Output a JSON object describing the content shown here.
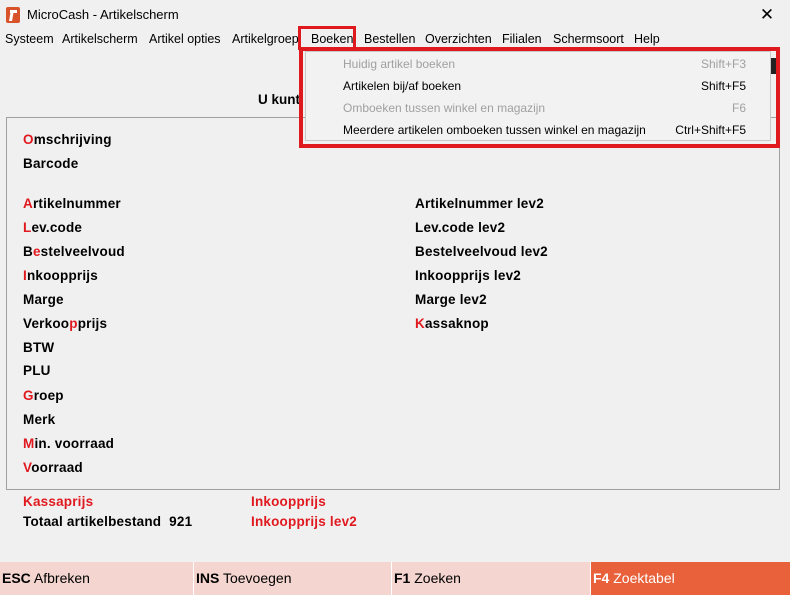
{
  "window": {
    "title": "MicroCash - Artikelscherm",
    "close_glyph": "✕"
  },
  "menu": {
    "items": [
      "Systeem",
      "Artikelscherm",
      "Artikel opties",
      "Artikelgroep",
      "Boeken",
      "Bestellen",
      "Overzichten",
      "Filialen",
      "Schermsoort",
      "Help"
    ]
  },
  "dropdown": {
    "items": [
      {
        "label": "Huidig artikel boeken",
        "shortcut": "Shift+F3",
        "enabled": false
      },
      {
        "label": "Artikelen bij/af boeken",
        "shortcut": "Shift+F5",
        "enabled": true
      },
      {
        "label": "Omboeken tussen winkel en magazijn",
        "shortcut": "F6",
        "enabled": false
      },
      {
        "label": "Meerdere artikelen omboeken tussen winkel en magazijn",
        "shortcut": "Ctrl+Shift+F5",
        "enabled": true
      }
    ]
  },
  "header": {
    "ukunt": "U kunt"
  },
  "fields": {
    "omschrijving": {
      "hot": "O",
      "rest": "mschrijving"
    },
    "barcode": "Barcode",
    "artikelnummer": {
      "hot": "A",
      "rest": "rtikelnummer"
    },
    "levcode": {
      "hot": "L",
      "rest": "ev.code"
    },
    "bestelveelvoud": {
      "pre": "B",
      "hot": "e",
      "rest": "stelveelvoud"
    },
    "inkoopprijs": {
      "hot": "I",
      "rest": "nkoopprijs"
    },
    "marge": "Marge",
    "verkoopprijs": {
      "pre": "Verkoo",
      "hot": "p",
      "rest": "prijs"
    },
    "btw": "BTW",
    "plu": "PLU",
    "groep": {
      "hot": "G",
      "rest": "roep"
    },
    "merk": "Merk",
    "minvoorraad": {
      "hot": "M",
      "rest": "in. voorraad"
    },
    "voorraad": {
      "hot": "V",
      "rest": "oorraad"
    },
    "artikelnummer_lev2": "Artikelnummer lev2",
    "levcode_lev2": "Lev.code lev2",
    "bestelveelvoud_lev2": "Bestelveelvoud lev2",
    "inkoopprijs_lev2": "Inkoopprijs lev2",
    "marge_lev2": "Marge lev2",
    "kassaknop": {
      "hot": "K",
      "rest": "assaknop"
    }
  },
  "summary": {
    "kassaprijs": "Kassaprijs",
    "totaal_label": "Totaal artikelbestand",
    "totaal_value": "921",
    "inkoopprijs": "Inkoopprijs",
    "inkoopprijs_lev2": "Inkoopprijs lev2"
  },
  "footer": {
    "buttons": [
      {
        "key": "ESC",
        "label": "Afbreken"
      },
      {
        "key": "INS",
        "label": "Toevoegen"
      },
      {
        "key": "F1",
        "label": "Zoeken"
      },
      {
        "key": "F4",
        "label": "Zoektabel"
      }
    ]
  },
  "colors": {
    "highlight_red": "#e0191f",
    "footer_bg": "#f4d5cf",
    "footer_active": "#e8613a"
  }
}
